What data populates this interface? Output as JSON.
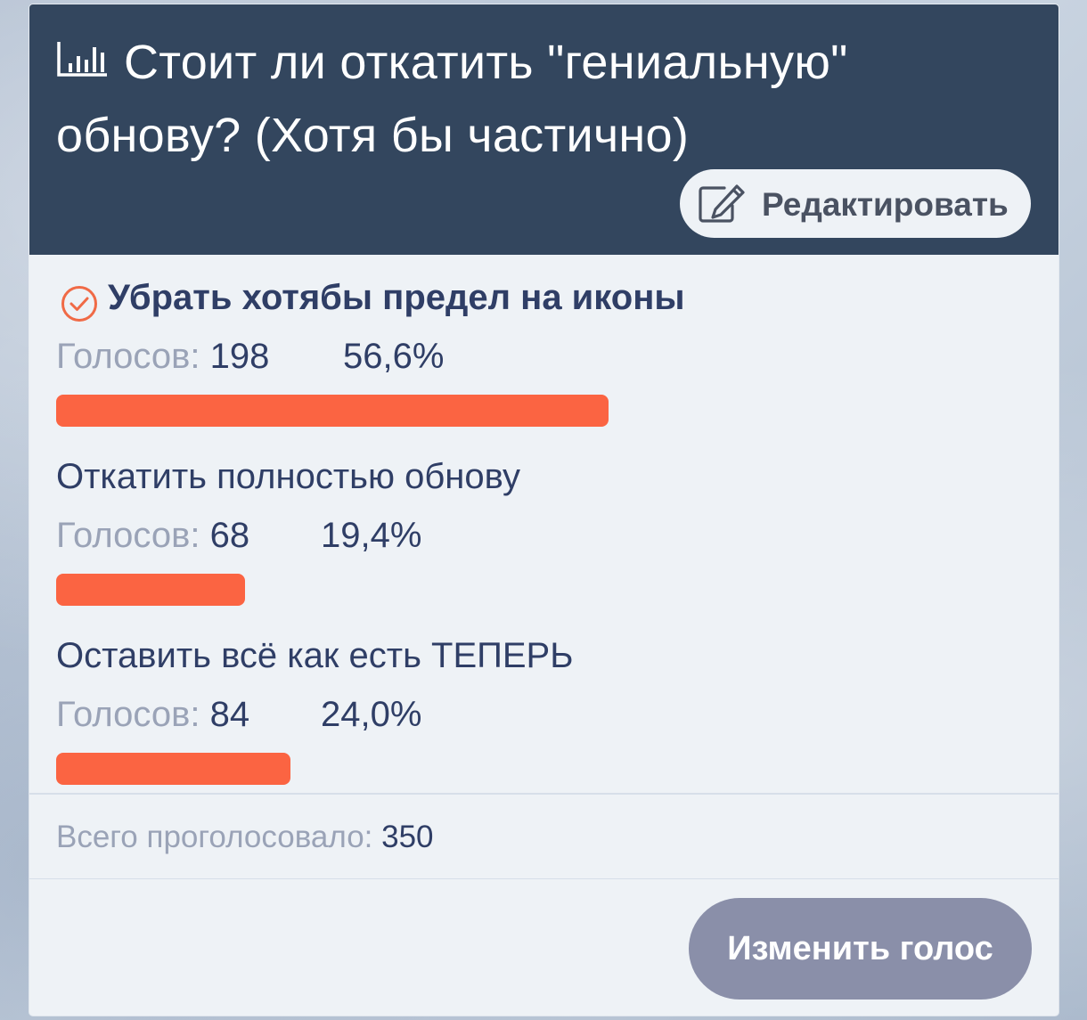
{
  "poll": {
    "title": "Стоит ли откатить \"гениальную\" обнову? (Хотя бы частично)",
    "title_icon": "poll-chart-icon",
    "edit_label": "Редактировать",
    "edit_icon": "edit-pencil-icon",
    "votes_label": "Голосов:",
    "options": [
      {
        "label": "Убрать хотябы предел на иконы",
        "votes": "198",
        "percent": "56,6%",
        "share": 0.566,
        "selected": true
      },
      {
        "label": "Откатить полностью обнову",
        "votes": "68",
        "percent": "19,4%",
        "share": 0.194,
        "selected": false
      },
      {
        "label": "Оставить всё как есть ТЕПЕРЬ",
        "votes": "84",
        "percent": "24,0%",
        "share": 0.24,
        "selected": false
      }
    ],
    "total_label": "Всего проголосовало:",
    "total_value": "350",
    "change_vote_label": "Изменить голос",
    "colors": {
      "header_bg": "#33465e",
      "bar": "#fb6442",
      "check": "#f06a46",
      "button_bg": "#8a8fa9"
    }
  }
}
